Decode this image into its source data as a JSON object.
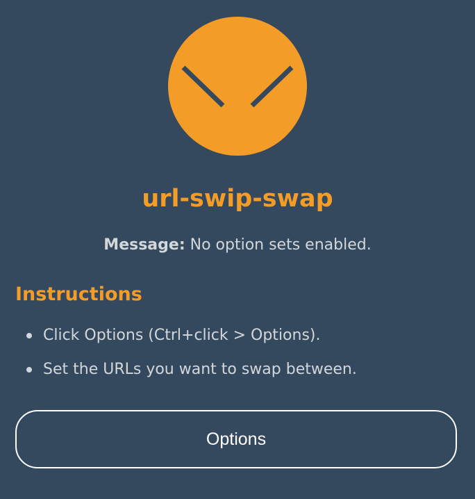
{
  "colors": {
    "background": "#34495e",
    "accent": "#f39c27",
    "text": "#d2d7dc",
    "button_border": "#ffffff"
  },
  "logo": {
    "icon": "chevron-face-logo-icon"
  },
  "header": {
    "title": "url-swip-swap"
  },
  "message": {
    "label": "Message:",
    "text": "No option sets enabled."
  },
  "instructions": {
    "heading": "Instructions",
    "items": [
      "Click Options (Ctrl+click > Options).",
      "Set the URLs you want to swap between."
    ]
  },
  "actions": {
    "options_label": "Options"
  }
}
